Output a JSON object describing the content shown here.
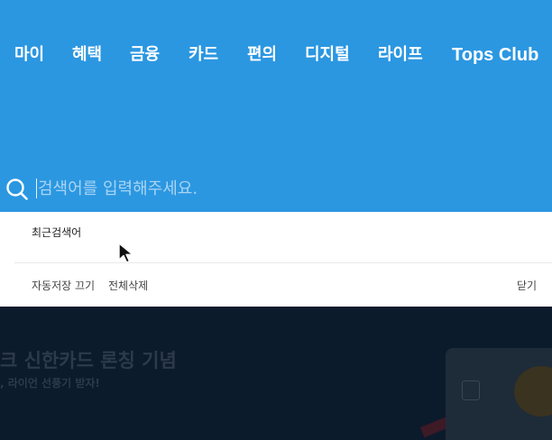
{
  "nav": {
    "items": [
      {
        "label": "마이"
      },
      {
        "label": "혜택"
      },
      {
        "label": "금융"
      },
      {
        "label": "카드"
      },
      {
        "label": "편의"
      },
      {
        "label": "디지털"
      },
      {
        "label": "라이프"
      },
      {
        "label": "Tops Club"
      }
    ]
  },
  "search": {
    "placeholder": "검색어를 입력해주세요.",
    "value": ""
  },
  "dropdown": {
    "recent_title": "최근검색어",
    "auto_save_off": "자동저장 끄기",
    "delete_all": "전체삭제",
    "close": "닫기"
  },
  "banner": {
    "title": "크 신한카드 론칭 기념",
    "subtitle": ", 라이언 선풍기 받자!"
  },
  "colors": {
    "header_bg": "#2b97e1",
    "page_bg": "#0c1b2c"
  }
}
